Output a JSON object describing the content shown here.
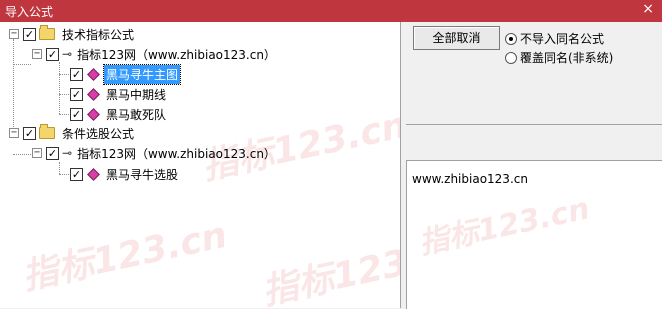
{
  "window": {
    "title": "导入公式",
    "close": "×"
  },
  "tree": {
    "root1": {
      "label": "技术指标公式",
      "expand": "−",
      "check": "✓"
    },
    "group1": {
      "label": "指标123网（www.zhibiao123.cn）",
      "expand": "−",
      "check": "✓"
    },
    "items1": [
      {
        "label": "黑马寻牛主图",
        "check": "✓"
      },
      {
        "label": "黑马中期线",
        "check": "✓"
      },
      {
        "label": "黑马敢死队",
        "check": "✓"
      }
    ],
    "root2": {
      "label": "条件选股公式",
      "expand": "−",
      "check": "✓"
    },
    "group2": {
      "label": "指标123网（www.zhibiao123.cn）",
      "expand": "−",
      "check": "✓"
    },
    "items2": [
      {
        "label": "黑马寻牛选股",
        "check": "✓"
      }
    ]
  },
  "actions": {
    "cancel_all": "全部取消"
  },
  "options": {
    "no_import_same": "不导入同名公式",
    "overwrite_same": "覆盖同名(非系统)",
    "selected": "no_import_same"
  },
  "info": {
    "url": "www.zhibiao123.cn"
  },
  "watermark": "指标123.cn"
}
